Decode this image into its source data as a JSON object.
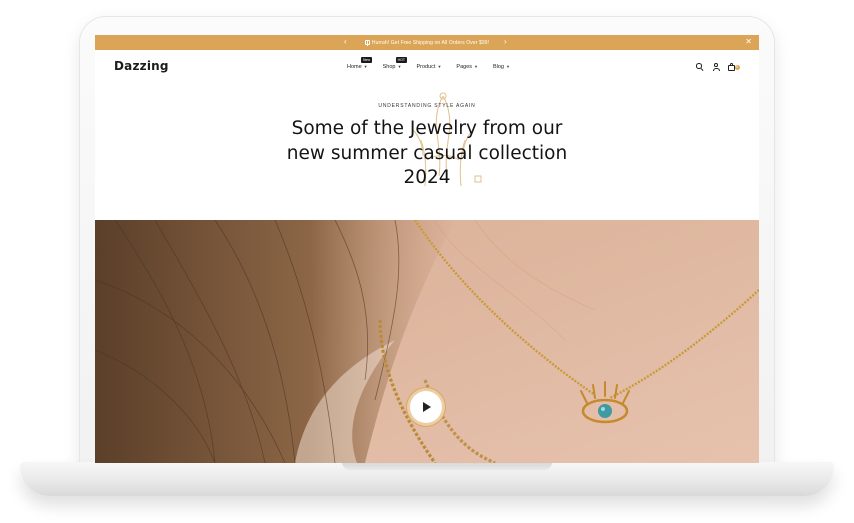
{
  "announcement": {
    "text": "Hurrah! Get Free Shipping on All Orders Over $99!",
    "prev_icon": "chevron-left-icon",
    "next_icon": "chevron-right-icon",
    "close_icon": "close-icon",
    "gift_icon": "gift-icon"
  },
  "header": {
    "logo": "Dazzing",
    "nav": [
      {
        "label": "Home",
        "badge": "New"
      },
      {
        "label": "Shop",
        "badge": "HOT"
      },
      {
        "label": "Product",
        "badge": ""
      },
      {
        "label": "Pages",
        "badge": ""
      },
      {
        "label": "Blog",
        "badge": ""
      }
    ],
    "cart_count": "0",
    "icons": [
      "search-icon",
      "user-icon",
      "cart-icon"
    ]
  },
  "hero": {
    "eyebrow": "UNDERSTANDING STYLE AGAIN",
    "headline": "Some of the Jewelry from our new summer casual collection 2024",
    "play_icon": "play-icon"
  },
  "colors": {
    "accent": "#dca456",
    "text": "#141414",
    "background": "#ffffff"
  }
}
